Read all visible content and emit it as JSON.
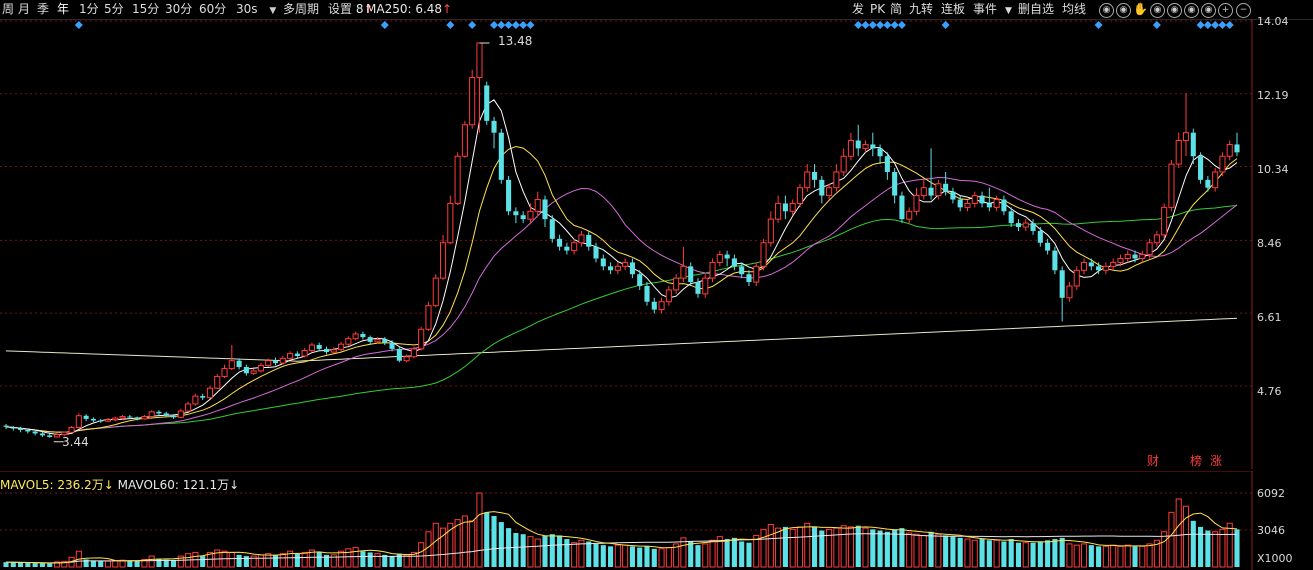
{
  "toolbar": {
    "periods": [
      "周",
      "月",
      "季",
      "年",
      "1分",
      "5分",
      "15分",
      "30分",
      "60分"
    ],
    "interval": "30s",
    "multi_period": "多周期",
    "settings": "设置",
    "settings_num": "8",
    "ma_label": "MA250: 6.48",
    "right_buttons": [
      "发",
      "PK",
      "简",
      "九转",
      "连板",
      "事件",
      "删自选",
      "均线"
    ]
  },
  "price_axis": {
    "labels": [
      "14.04",
      "12.19",
      "10.34",
      "8.46",
      "6.61",
      "4.76"
    ]
  },
  "annotations": {
    "high": "13.48",
    "low": "3.44"
  },
  "events": [
    "财",
    "榜",
    "涨"
  ],
  "volume": {
    "mavol5_label": "MAVOL5: 236.2万",
    "mavol60_label": "MAVOL60: 121.1万",
    "axis_labels": [
      "6092",
      "3046",
      "X1000"
    ]
  },
  "chart_data": {
    "type": "candlestick",
    "ylim": [
      2.9,
      14.04
    ],
    "vol_ylim": [
      0,
      6092
    ],
    "candles": [
      [
        3.75,
        3.72,
        3.79,
        3.66
      ],
      [
        3.7,
        3.68,
        3.74,
        3.62
      ],
      [
        3.68,
        3.64,
        3.72,
        3.58
      ],
      [
        3.64,
        3.6,
        3.68,
        3.55
      ],
      [
        3.6,
        3.55,
        3.64,
        3.5
      ],
      [
        3.55,
        3.5,
        3.6,
        3.46
      ],
      [
        3.5,
        3.46,
        3.55,
        3.44
      ],
      [
        3.46,
        3.52,
        3.56,
        3.44
      ],
      [
        3.52,
        3.58,
        3.6,
        3.48
      ],
      [
        3.58,
        3.7,
        3.74,
        3.56
      ],
      [
        3.7,
        4.0,
        4.06,
        3.68
      ],
      [
        4.0,
        3.92,
        4.04,
        3.86
      ],
      [
        3.92,
        3.88,
        3.96,
        3.84
      ],
      [
        3.88,
        3.86,
        3.92,
        3.82
      ],
      [
        3.86,
        3.9,
        3.94,
        3.84
      ],
      [
        3.9,
        3.94,
        3.98,
        3.86
      ],
      [
        3.94,
        3.98,
        4.02,
        3.9
      ],
      [
        3.98,
        3.96,
        4.02,
        3.92
      ],
      [
        3.96,
        3.92,
        3.98,
        3.88
      ],
      [
        3.92,
        3.98,
        4.02,
        3.9
      ],
      [
        3.98,
        4.1,
        4.14,
        3.96
      ],
      [
        4.1,
        4.06,
        4.14,
        4.0
      ],
      [
        4.06,
        4.0,
        4.1,
        3.96
      ],
      [
        4.0,
        3.96,
        4.04,
        3.92
      ],
      [
        3.96,
        4.12,
        4.18,
        3.94
      ],
      [
        4.12,
        4.3,
        4.36,
        4.1
      ],
      [
        4.3,
        4.5,
        4.56,
        4.26
      ],
      [
        4.5,
        4.46,
        4.56,
        4.4
      ],
      [
        4.46,
        4.7,
        4.76,
        4.44
      ],
      [
        4.7,
        5.0,
        5.06,
        4.68
      ],
      [
        5.0,
        5.2,
        5.3,
        4.96
      ],
      [
        5.2,
        5.4,
        5.8,
        5.16
      ],
      [
        5.4,
        5.24,
        5.46,
        5.18
      ],
      [
        5.24,
        5.08,
        5.3,
        5.02
      ],
      [
        5.08,
        5.14,
        5.2,
        5.04
      ],
      [
        5.14,
        5.28,
        5.34,
        5.1
      ],
      [
        5.28,
        5.4,
        5.46,
        5.24
      ],
      [
        5.4,
        5.34,
        5.48,
        5.28
      ],
      [
        5.34,
        5.46,
        5.52,
        5.3
      ],
      [
        5.46,
        5.58,
        5.64,
        5.42
      ],
      [
        5.58,
        5.52,
        5.64,
        5.46
      ],
      [
        5.52,
        5.66,
        5.72,
        5.48
      ],
      [
        5.66,
        5.8,
        5.86,
        5.62
      ],
      [
        5.8,
        5.7,
        5.86,
        5.64
      ],
      [
        5.7,
        5.62,
        5.76,
        5.56
      ],
      [
        5.62,
        5.68,
        5.74,
        5.58
      ],
      [
        5.68,
        5.82,
        5.88,
        5.64
      ],
      [
        5.82,
        5.96,
        6.02,
        5.78
      ],
      [
        5.96,
        6.08,
        6.14,
        5.92
      ],
      [
        6.08,
        6.0,
        6.14,
        5.94
      ],
      [
        6.0,
        5.88,
        6.04,
        5.82
      ],
      [
        5.88,
        5.94,
        6.0,
        5.84
      ],
      [
        5.94,
        5.86,
        6.0,
        5.8
      ],
      [
        5.86,
        5.7,
        5.92,
        5.64
      ],
      [
        5.7,
        5.4,
        5.74,
        5.36
      ],
      [
        5.4,
        5.5,
        5.56,
        5.36
      ],
      [
        5.5,
        5.7,
        5.76,
        5.46
      ],
      [
        5.7,
        6.2,
        6.26,
        5.66
      ],
      [
        6.2,
        6.8,
        6.9,
        6.16
      ],
      [
        6.8,
        7.5,
        7.6,
        6.76
      ],
      [
        7.5,
        8.4,
        8.6,
        7.46
      ],
      [
        8.4,
        9.4,
        9.6,
        8.36
      ],
      [
        9.4,
        10.6,
        10.7,
        9.36
      ],
      [
        10.6,
        11.4,
        11.5,
        10.56
      ],
      [
        11.4,
        12.6,
        12.8,
        11.3
      ],
      [
        12.6,
        13.48,
        13.48,
        11.2
      ],
      [
        12.4,
        11.5,
        12.5,
        11.4
      ],
      [
        11.5,
        11.2,
        11.6,
        10.8
      ],
      [
        11.2,
        10.0,
        11.3,
        9.9
      ],
      [
        10.0,
        9.2,
        10.1,
        9.1
      ],
      [
        9.2,
        9.1,
        9.3,
        8.9
      ],
      [
        9.1,
        9.0,
        9.2,
        8.9
      ],
      [
        9.0,
        9.2,
        9.4,
        8.9
      ],
      [
        9.2,
        9.5,
        9.7,
        9.1
      ],
      [
        9.5,
        9.0,
        9.6,
        8.8
      ],
      [
        9.0,
        8.5,
        9.1,
        8.4
      ],
      [
        8.5,
        8.3,
        8.6,
        8.2
      ],
      [
        8.3,
        8.2,
        8.4,
        8.1
      ],
      [
        8.2,
        8.4,
        8.5,
        8.1
      ],
      [
        8.4,
        8.6,
        8.7,
        8.3
      ],
      [
        8.6,
        8.3,
        8.7,
        8.2
      ],
      [
        8.3,
        8.0,
        8.4,
        7.9
      ],
      [
        8.0,
        7.8,
        8.1,
        7.7
      ],
      [
        7.8,
        7.7,
        7.9,
        7.6
      ],
      [
        7.7,
        7.8,
        7.9,
        7.6
      ],
      [
        7.8,
        7.9,
        8.0,
        7.7
      ],
      [
        7.9,
        7.6,
        8.0,
        7.5
      ],
      [
        7.6,
        7.3,
        7.7,
        7.2
      ],
      [
        7.3,
        6.9,
        7.4,
        6.8
      ],
      [
        6.9,
        6.7,
        7.0,
        6.6
      ],
      [
        6.7,
        6.9,
        7.0,
        6.6
      ],
      [
        6.9,
        7.2,
        7.3,
        6.8
      ],
      [
        7.2,
        7.5,
        7.6,
        7.1
      ],
      [
        7.5,
        7.8,
        8.3,
        7.4
      ],
      [
        7.8,
        7.4,
        7.9,
        7.3
      ],
      [
        7.4,
        7.1,
        7.5,
        7.0
      ],
      [
        7.1,
        7.5,
        7.6,
        7.0
      ],
      [
        7.5,
        7.9,
        8.0,
        7.4
      ],
      [
        7.9,
        8.1,
        8.2,
        7.8
      ],
      [
        8.1,
        8.0,
        8.2,
        7.8
      ],
      [
        8.0,
        7.8,
        8.1,
        7.7
      ],
      [
        7.8,
        7.6,
        7.9,
        7.5
      ],
      [
        7.6,
        7.4,
        7.7,
        7.3
      ],
      [
        7.4,
        7.8,
        7.9,
        7.3
      ],
      [
        7.8,
        8.4,
        8.5,
        7.7
      ],
      [
        8.4,
        9.0,
        9.2,
        8.3
      ],
      [
        9.0,
        9.4,
        9.6,
        8.9
      ],
      [
        9.4,
        9.2,
        9.6,
        9.0
      ],
      [
        9.2,
        9.4,
        9.5,
        9.1
      ],
      [
        9.4,
        9.8,
        9.9,
        9.3
      ],
      [
        9.8,
        10.2,
        10.4,
        9.7
      ],
      [
        10.2,
        10.0,
        10.4,
        9.8
      ],
      [
        10.0,
        9.6,
        10.1,
        9.4
      ],
      [
        9.6,
        9.8,
        9.9,
        9.5
      ],
      [
        9.8,
        10.2,
        10.4,
        9.7
      ],
      [
        10.2,
        10.6,
        10.8,
        10.1
      ],
      [
        10.6,
        11.0,
        11.2,
        10.5
      ],
      [
        11.0,
        10.8,
        11.4,
        10.6
      ],
      [
        10.8,
        10.9,
        11.0,
        10.7
      ],
      [
        10.9,
        10.8,
        11.2,
        10.6
      ],
      [
        10.8,
        10.6,
        10.9,
        10.4
      ],
      [
        10.6,
        10.2,
        10.7,
        10.0
      ],
      [
        10.2,
        9.6,
        10.3,
        9.4
      ],
      [
        9.6,
        9.0,
        9.7,
        8.9
      ],
      [
        9.0,
        9.2,
        9.3,
        8.9
      ],
      [
        9.2,
        9.6,
        9.8,
        9.1
      ],
      [
        9.6,
        9.8,
        10.0,
        9.5
      ],
      [
        9.8,
        9.6,
        10.8,
        9.5
      ],
      [
        9.6,
        9.9,
        10.0,
        9.5
      ],
      [
        9.9,
        9.7,
        10.2,
        9.6
      ],
      [
        9.7,
        9.5,
        9.8,
        9.4
      ],
      [
        9.5,
        9.3,
        9.6,
        9.2
      ],
      [
        9.3,
        9.4,
        9.5,
        9.2
      ],
      [
        9.4,
        9.6,
        9.7,
        9.3
      ],
      [
        9.6,
        9.4,
        9.7,
        9.3
      ],
      [
        9.4,
        9.3,
        9.8,
        9.2
      ],
      [
        9.3,
        9.5,
        9.6,
        9.2
      ],
      [
        9.5,
        9.2,
        9.6,
        9.1
      ],
      [
        9.2,
        8.9,
        9.3,
        8.8
      ],
      [
        8.9,
        8.8,
        9.0,
        8.7
      ],
      [
        8.8,
        8.9,
        9.0,
        8.7
      ],
      [
        8.9,
        8.7,
        9.0,
        8.6
      ],
      [
        8.7,
        8.4,
        8.8,
        8.3
      ],
      [
        8.4,
        8.2,
        8.5,
        8.1
      ],
      [
        8.2,
        7.7,
        8.3,
        7.6
      ],
      [
        7.7,
        7.0,
        7.8,
        6.4
      ],
      [
        7.0,
        7.3,
        7.4,
        6.9
      ],
      [
        7.3,
        7.7,
        7.8,
        7.2
      ],
      [
        7.7,
        7.9,
        8.0,
        7.6
      ],
      [
        7.9,
        7.8,
        8.0,
        7.7
      ],
      [
        7.8,
        7.7,
        7.9,
        7.6
      ],
      [
        7.7,
        7.8,
        7.9,
        7.6
      ],
      [
        7.8,
        7.9,
        8.0,
        7.7
      ],
      [
        7.9,
        8.0,
        8.1,
        7.8
      ],
      [
        8.0,
        8.1,
        8.2,
        7.9
      ],
      [
        8.1,
        8.0,
        8.2,
        7.9
      ],
      [
        8.0,
        8.1,
        8.2,
        7.9
      ],
      [
        8.1,
        8.4,
        8.5,
        8.0
      ],
      [
        8.4,
        8.6,
        8.7,
        8.3
      ],
      [
        8.6,
        9.3,
        9.4,
        8.5
      ],
      [
        9.3,
        10.4,
        10.5,
        9.2
      ],
      [
        10.4,
        11.0,
        11.2,
        10.3
      ],
      [
        11.0,
        11.2,
        12.2,
        10.6
      ],
      [
        11.2,
        10.6,
        11.3,
        10.4
      ],
      [
        10.6,
        10.0,
        10.7,
        9.9
      ],
      [
        10.0,
        9.8,
        10.1,
        9.7
      ],
      [
        9.8,
        10.2,
        10.3,
        9.7
      ],
      [
        10.2,
        10.6,
        10.7,
        10.1
      ],
      [
        10.6,
        10.9,
        11.0,
        10.5
      ],
      [
        10.9,
        10.7,
        11.2,
        10.6
      ]
    ],
    "volumes": [
      400,
      380,
      360,
      340,
      320,
      300,
      280,
      420,
      460,
      800,
      1300,
      620,
      540,
      500,
      480,
      520,
      560,
      540,
      500,
      620,
      900,
      700,
      600,
      560,
      900,
      1100,
      1200,
      900,
      1200,
      1400,
      1300,
      1200,
      1000,
      900,
      900,
      1000,
      1100,
      1000,
      1100,
      1300,
      1100,
      1200,
      1400,
      1200,
      1000,
      1000,
      1300,
      1500,
      1600,
      1300,
      1200,
      1100,
      1000,
      900,
      1100,
      1000,
      1200,
      2000,
      2900,
      3600,
      3200,
      3600,
      3900,
      4200,
      3800,
      6092,
      4500,
      4200,
      3700,
      3200,
      2800,
      2700,
      2500,
      2300,
      2600,
      2700,
      2600,
      2300,
      2000,
      2200,
      2100,
      1900,
      1800,
      1700,
      1800,
      1800,
      1700,
      1600,
      1700,
      1500,
      1500,
      1600,
      1900,
      2400,
      2100,
      1800,
      1900,
      2200,
      2500,
      2300,
      2400,
      2100,
      2000,
      2600,
      3100,
      3500,
      3200,
      3300,
      3100,
      3300,
      3600,
      3300,
      3000,
      3100,
      3200,
      3400,
      3300,
      3400,
      3200,
      3100,
      3000,
      2900,
      3100,
      3200,
      2800,
      2700,
      2600,
      2900,
      2700,
      2600,
      2500,
      2400,
      2300,
      2200,
      2300,
      2200,
      2200,
      2100,
      2300,
      2000,
      2000,
      2000,
      2100,
      2200,
      2300,
      2400,
      1900,
      1800,
      1900,
      1800,
      1700,
      1700,
      1800,
      1700,
      1800,
      1700,
      1700,
      1900,
      2200,
      2900,
      4500,
      5600,
      5000,
      3800,
      3300,
      3000,
      2900,
      3100,
      3600,
      3100
    ],
    "ma_colors": {
      "ma5": "#ffffff",
      "ma10": "#ffe24a",
      "ma20": "#d36bd8",
      "ma60": "#33cc33",
      "ma250": "#e6e6c8"
    },
    "up_color": "#ff3b3b",
    "down_color": "#5ce1e6"
  }
}
